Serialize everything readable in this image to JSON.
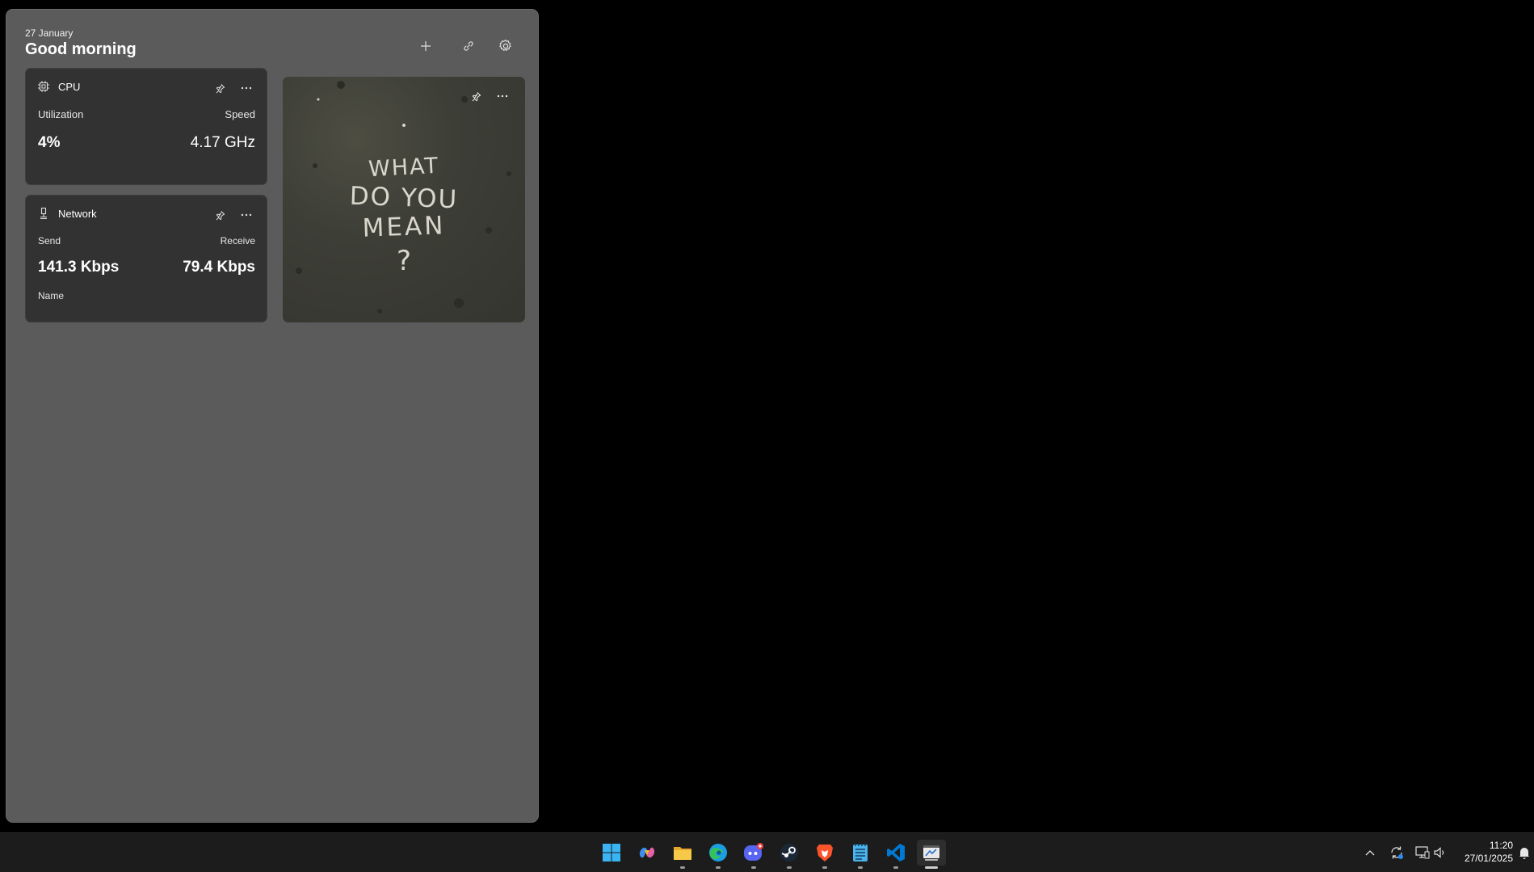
{
  "header": {
    "date": "27 January",
    "greeting": "Good morning"
  },
  "cpu": {
    "title": "CPU",
    "util_label": "Utilization",
    "speed_label": "Speed",
    "util_value": "4%",
    "speed_value": "4.17 GHz"
  },
  "network": {
    "title": "Network",
    "send_label": "Send",
    "receive_label": "Receive",
    "send_value": "141.3 Kbps",
    "receive_value": "79.4 Kbps",
    "name_label": "Name"
  },
  "photo": {
    "text_line1": "WHAT",
    "text_line2": "DO YOU",
    "text_line3": "MEAN",
    "text_line4": "?"
  },
  "clock": {
    "time": "11:20",
    "date": "27/01/2025"
  },
  "colors": {
    "board": "#5b5b5b",
    "card": "#323232",
    "taskbar": "#1c1c1c",
    "accent": "#0078d4"
  }
}
